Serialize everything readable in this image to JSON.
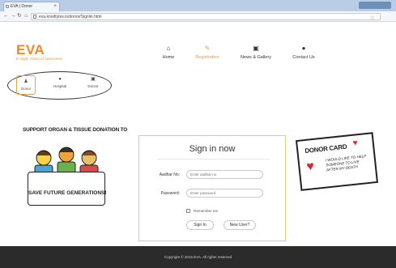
{
  "browser": {
    "tab_title": "EVA | Donor",
    "url": "eva.knodtytes.in/donor/Signlin.html"
  },
  "site": {
    "logo": "EVA",
    "tagline": "E-Vigile Vision of Awareness"
  },
  "nav": {
    "items": [
      {
        "label": "Home",
        "icon": "home-icon"
      },
      {
        "label": "Registration",
        "icon": "pencil-icon"
      },
      {
        "label": "News & Gallery",
        "icon": "photo-icon"
      },
      {
        "label": "Contact Us",
        "icon": "contact-icon"
      }
    ],
    "active": "Registration"
  },
  "roles": {
    "items": [
      {
        "label": "Donor"
      },
      {
        "label": "Hospital"
      },
      {
        "label": "Doctor"
      }
    ],
    "selected": "Donor"
  },
  "left_banner": {
    "top_text": "SUPPORT ORGAN & TISSUE DONATION TO",
    "sign_text": "SAVE FUTURE GENERATIONS!"
  },
  "signin": {
    "title": "Sign in now",
    "aadhar_label": "Aadhar No:",
    "aadhar_placeholder": "Enter aadhar no",
    "password_label": "Password:",
    "password_placeholder": "Enter password",
    "remember_label": "Remember me",
    "signin_button": "Sign In",
    "newuser_button": "New User?"
  },
  "donor_card": {
    "title": "DONOR CARD",
    "text": "I WOULD LIKE TO HELP SOMEONE TO LIVE AFTER MY DEATH"
  },
  "footer": {
    "copyright": "Copyright © 2015 EVA. All rights reserved"
  },
  "colors": {
    "brand": "#f08a24",
    "card_border": "#f0c873",
    "footer_bg": "#2b2b2b"
  }
}
